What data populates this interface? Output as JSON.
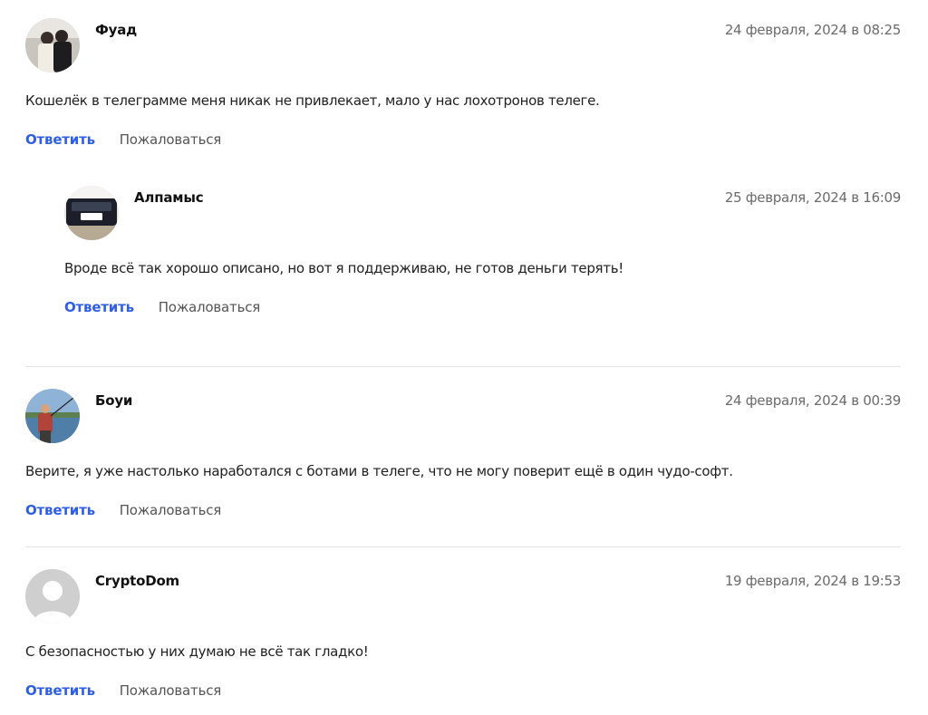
{
  "comments": [
    {
      "author": "Фуад",
      "date": "24 февраля, 2024 в 08:25",
      "text": "Кошелёк в телеграмме меня никак не привлекает, мало у нас лохотронов телеге.",
      "reply_label": "Ответить",
      "report_label": "Пожаловаться",
      "avatar_icon": "user-photo-icon"
    },
    {
      "author": "Алпамыс",
      "date": "25 февраля, 2024 в 16:09",
      "text": "Вроде всё так хорошо описано, но вот я поддерживаю, не готов деньги терять!",
      "reply_label": "Ответить",
      "report_label": "Пожаловаться",
      "avatar_icon": "car-photo-icon"
    },
    {
      "author": "Боуи",
      "date": "24 февраля, 2024 в 00:39",
      "text": "Верите, я уже настолько наработался с ботами в телеге, что не могу поверит ещё в один чудо-софт.",
      "reply_label": "Ответить",
      "report_label": "Пожаловаться",
      "avatar_icon": "fishing-photo-icon"
    },
    {
      "author": "CryptoDom",
      "date": "19 февраля, 2024 в 19:53",
      "text": "С безопасностью у них думаю не всё так гладко!",
      "reply_label": "Ответить",
      "report_label": "Пожаловаться",
      "avatar_icon": "default-avatar-icon"
    }
  ],
  "colors": {
    "link_blue": "#2f5ee6",
    "date_gray": "#6b6b6b",
    "divider": "#e6e6e6"
  }
}
